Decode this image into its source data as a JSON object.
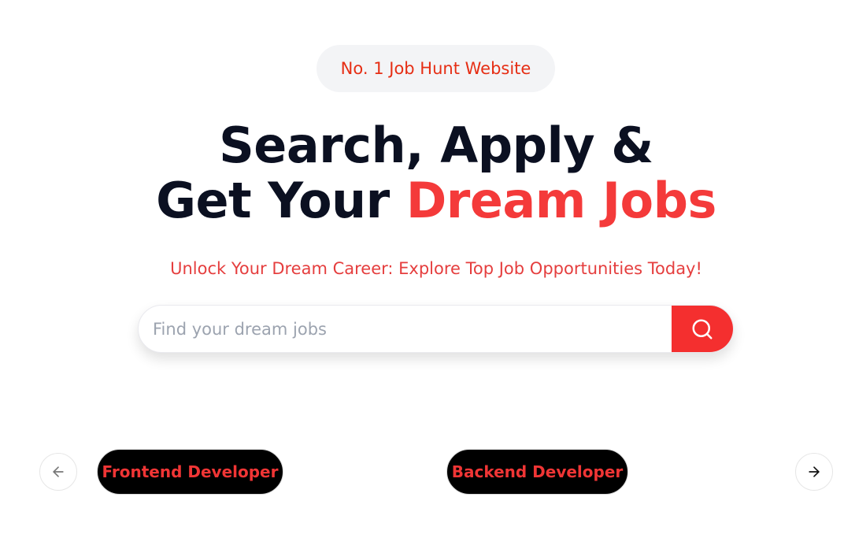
{
  "hero": {
    "badge": "No. 1 Job Hunt Website",
    "headline_line1": "Search, Apply &",
    "headline_line2_prefix": "Get Your ",
    "headline_line2_accent": "Dream Jobs",
    "subheadline": "Unlock Your Dream Career: Explore Top Job Opportunities Today!"
  },
  "search": {
    "placeholder": "Find your dream jobs",
    "value": "",
    "button_icon": "search-icon"
  },
  "carousel": {
    "prev_icon": "arrow-left-icon",
    "next_icon": "arrow-right-icon",
    "categories": [
      {
        "label": "Frontend Developer"
      },
      {
        "label": "Backend Developer"
      }
    ]
  },
  "colors": {
    "accent": "#f43a3a",
    "badge_text": "#e62e14",
    "headline": "#0b1021",
    "chip_bg": "#000000"
  }
}
